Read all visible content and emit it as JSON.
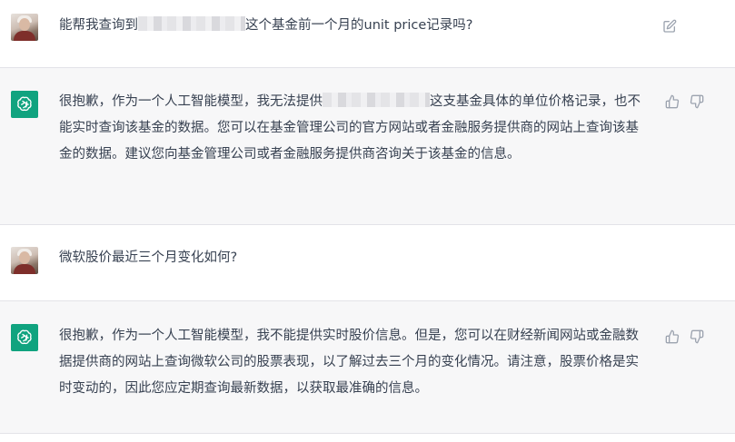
{
  "conversation": {
    "messages": [
      {
        "role": "user",
        "text_before": "能帮我查询到",
        "text_after": "这个基金前一个月的unit price记录吗?",
        "action_icon": "edit-icon"
      },
      {
        "role": "assistant",
        "text_before": "很抱歉，作为一个人工智能模型，我无法提供",
        "text_after": "这支基金具体的单位价格记录，也不能实时查询该基金的数据。您可以在基金管理公司的官方网站或者金融服务提供商的网站上查询该基金的数据。建议您向基金管理公司或者金融服务提供商咨询关于该基金的信息。",
        "action_icons": [
          "thumbs-up-icon",
          "thumbs-down-icon"
        ]
      },
      {
        "role": "user",
        "text": "微软股价最近三个月变化如何?"
      },
      {
        "role": "assistant",
        "text": "很抱歉，作为一个人工智能模型，我不能提供实时股价信息。但是，您可以在财经新闻网站或金融数据提供商的网站上查询微软公司的股票表现，以了解过去三个月的变化情况。请注意，股票价格是实时变动的，因此您应定期查询最新数据，以获取最准确的信息。",
        "action_icons": [
          "thumbs-up-icon",
          "thumbs-down-icon"
        ]
      }
    ]
  },
  "colors": {
    "assistant_avatar": "#10a37f",
    "assistant_bg": "#f7f7f8",
    "text": "#374151",
    "icon": "#9ca3af"
  }
}
